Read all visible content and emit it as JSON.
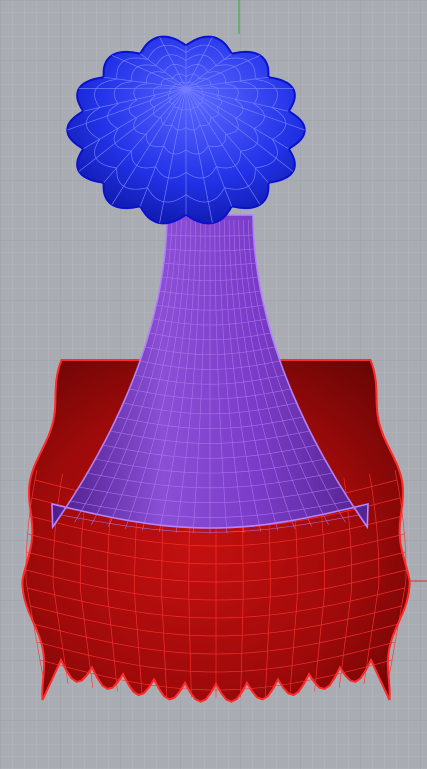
{
  "viewport": {
    "type": "3d-perspective-viewport",
    "background_color": "#a9adb3",
    "grid": {
      "visible": true,
      "minor_color": "#b6bac0",
      "major_color": "#9aa0a7"
    },
    "world_axes": [
      {
        "name": "y-axis",
        "color": "#35b54a"
      },
      {
        "name": "x-axis",
        "color": "#d04848"
      }
    ]
  },
  "objects": [
    {
      "name": "base-flare-surface",
      "color": "#d11414",
      "edge_color": "#ff3a3a",
      "state": "selected"
    },
    {
      "name": "neck-surface",
      "color": "#7a36c4",
      "edge_color": "#b07af2",
      "state": "selected"
    },
    {
      "name": "cap-surface",
      "color": "#1a28e6",
      "edge_color": "#6a76ff",
      "state": "selected"
    }
  ]
}
